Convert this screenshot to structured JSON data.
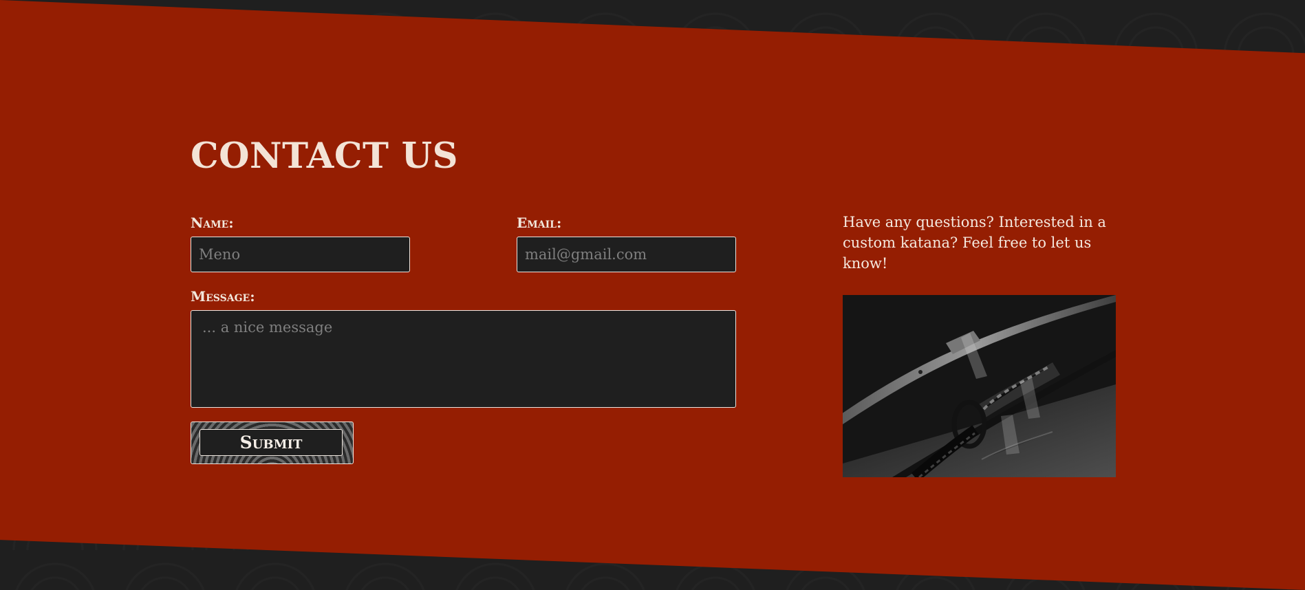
{
  "contact": {
    "title": "CONTACT US",
    "name_label": "Name:",
    "name_placeholder": "Meno",
    "email_label": "Email:",
    "email_placeholder": "mail@gmail.com",
    "message_label": "Message:",
    "message_placeholder": "... a nice message",
    "submit_label": "Submit"
  },
  "aside": {
    "description": "Have any questions? Interested in a custom katana? Feel free to let us know!",
    "image_subject": "katana"
  },
  "colors": {
    "accent_red": "#951e02",
    "background_dark": "#1f1f1f",
    "text_light": "#f3e3d6"
  },
  "icons": {
    "decorative_pattern": "seigaiha-wave-pattern"
  }
}
